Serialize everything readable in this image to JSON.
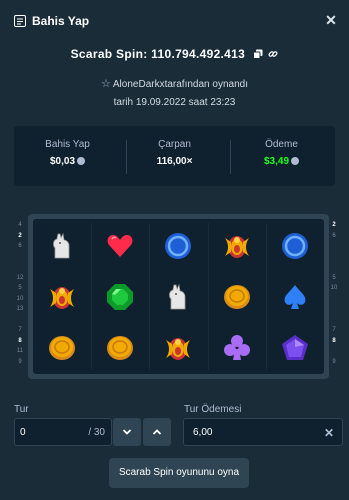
{
  "header": {
    "title": "Bahis Yap",
    "close_icon": "close-icon",
    "title_icon": "bet-slip-icon"
  },
  "game": {
    "id_text": "Scarab Spin: 110.794.492.413",
    "player_text": "AloneDarkxtarafından oynandı",
    "date_text": "tarih 19.09.2022 saat 23:23"
  },
  "stats": {
    "bet_label": "Bahis Yap",
    "bet_value": "$0,03",
    "multiplier_label": "Çarpan",
    "multiplier_value": "116,00×",
    "payout_label": "Ödeme",
    "payout_value": "$3,49",
    "payout_color": "#1fff20"
  },
  "left_row_numbers": [
    "4",
    "2",
    "6",
    "",
    "",
    "12",
    "5",
    "10",
    "13",
    "",
    "7",
    "8",
    "11",
    "9"
  ],
  "right_row_numbers": [
    "2",
    "6",
    "",
    "",
    "",
    "5",
    "10",
    "",
    "",
    "",
    "7",
    "8",
    "",
    "9"
  ],
  "reels": [
    [
      "anubis-jackal",
      "scarab-beetle",
      "gold-coin"
    ],
    [
      "red-heart",
      "green-emerald",
      "gold-coin"
    ],
    [
      "blue-ring",
      "anubis-jackal",
      "scarab-beetle"
    ],
    [
      "scarab-beetle",
      "gold-coin",
      "purple-club"
    ],
    [
      "blue-ring",
      "blue-spade",
      "purple-pentagon"
    ]
  ],
  "controls": {
    "round_label": "Tur",
    "round_value": "0",
    "round_total": "/ 30",
    "round_payout_label": "Tur Ödemesi",
    "round_payout_value": "6,00",
    "play_label": "Scarab Spin oyununu oyna"
  }
}
